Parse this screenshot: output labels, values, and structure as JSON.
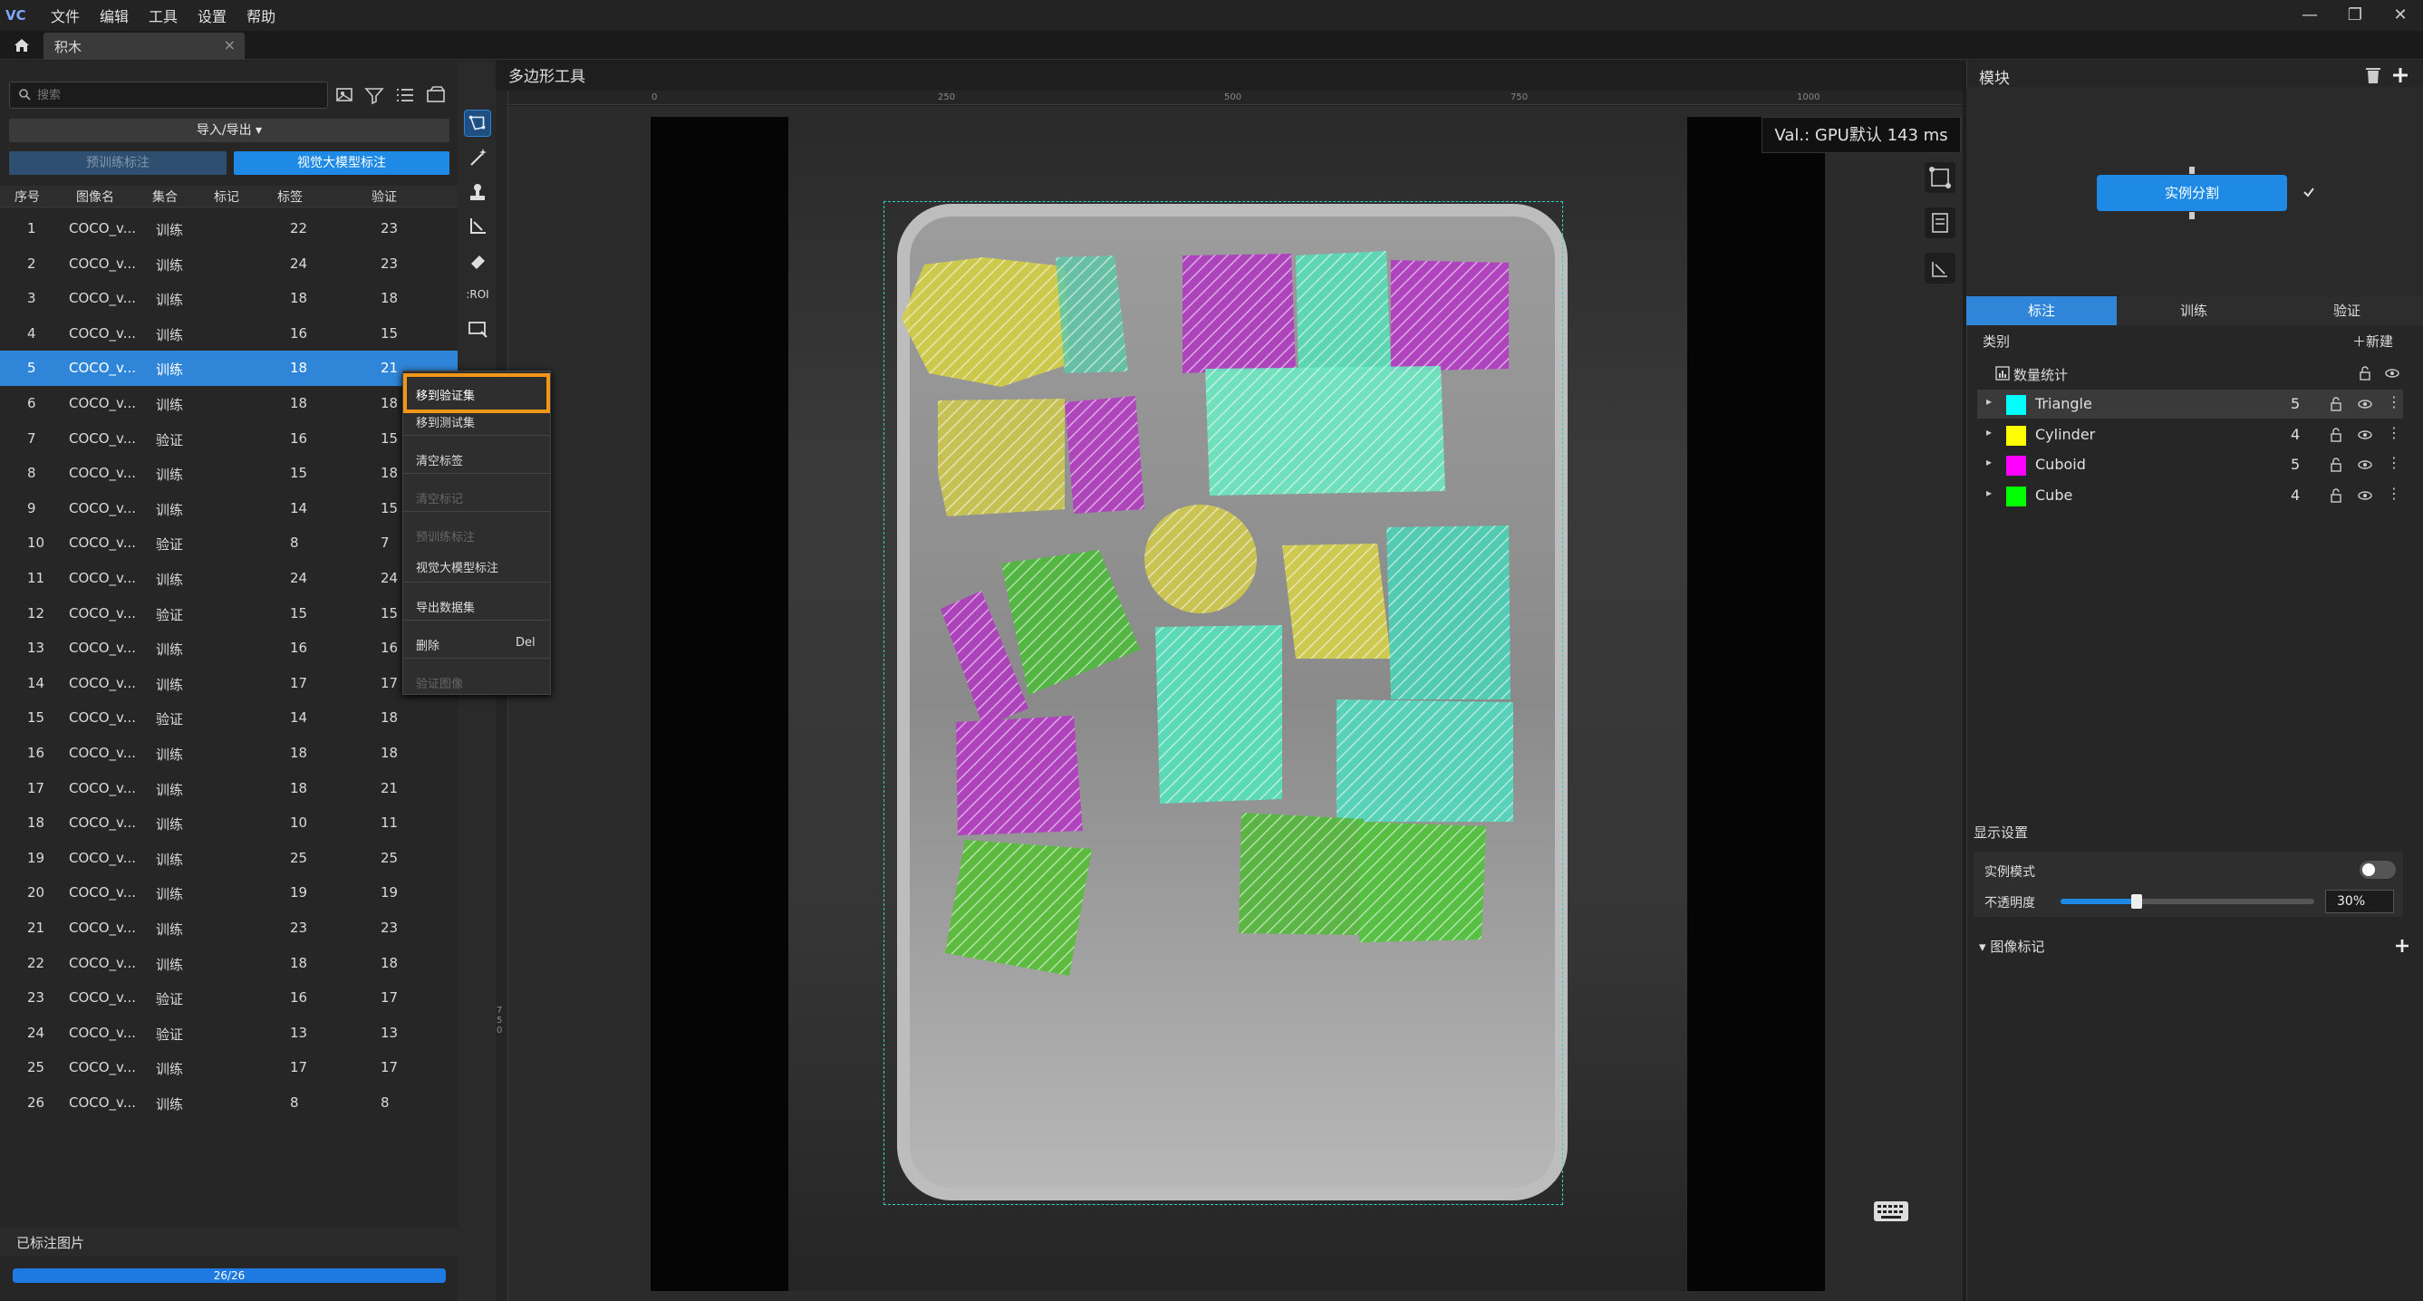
{
  "menubar": {
    "logo": "VC",
    "items": [
      "文件",
      "编辑",
      "工具",
      "设置",
      "帮助"
    ],
    "window_controls": [
      "—",
      "❐",
      "✕"
    ]
  },
  "tab": {
    "label": "积木",
    "close": "×"
  },
  "left": {
    "search_placeholder": "搜索",
    "import_export": "导入/导出 ▾",
    "pretrain_btn": "预训练标注",
    "vlm_btn": "视觉大模型标注",
    "headers": [
      "序号",
      "图像名",
      "集合",
      "标记",
      "标签",
      "验证"
    ],
    "rows": [
      [
        "1",
        "COCO_v...",
        "训练",
        "",
        "22",
        "23"
      ],
      [
        "2",
        "COCO_v...",
        "训练",
        "",
        "24",
        "23"
      ],
      [
        "3",
        "COCO_v...",
        "训练",
        "",
        "18",
        "18"
      ],
      [
        "4",
        "COCO_v...",
        "训练",
        "",
        "16",
        "15"
      ],
      [
        "5",
        "COCO_v...",
        "训练",
        "",
        "18",
        "21"
      ],
      [
        "6",
        "COCO_v...",
        "训练",
        "",
        "18",
        "18"
      ],
      [
        "7",
        "COCO_v...",
        "验证",
        "",
        "16",
        "15"
      ],
      [
        "8",
        "COCO_v...",
        "训练",
        "",
        "15",
        "18"
      ],
      [
        "9",
        "COCO_v...",
        "训练",
        "",
        "14",
        "15"
      ],
      [
        "10",
        "COCO_v...",
        "验证",
        "",
        "8",
        "7"
      ],
      [
        "11",
        "COCO_v...",
        "训练",
        "",
        "24",
        "24"
      ],
      [
        "12",
        "COCO_v...",
        "验证",
        "",
        "15",
        "15"
      ],
      [
        "13",
        "COCO_v...",
        "训练",
        "",
        "16",
        "16"
      ],
      [
        "14",
        "COCO_v...",
        "训练",
        "",
        "17",
        "17"
      ],
      [
        "15",
        "COCO_v...",
        "验证",
        "",
        "14",
        "18"
      ],
      [
        "16",
        "COCO_v...",
        "训练",
        "",
        "18",
        "18"
      ],
      [
        "17",
        "COCO_v...",
        "训练",
        "",
        "18",
        "21"
      ],
      [
        "18",
        "COCO_v...",
        "训练",
        "",
        "10",
        "11"
      ],
      [
        "19",
        "COCO_v...",
        "训练",
        "",
        "25",
        "25"
      ],
      [
        "20",
        "COCO_v...",
        "训练",
        "",
        "19",
        "19"
      ],
      [
        "21",
        "COCO_v...",
        "训练",
        "",
        "23",
        "23"
      ],
      [
        "22",
        "COCO_v...",
        "训练",
        "",
        "18",
        "18"
      ],
      [
        "23",
        "COCO_v...",
        "验证",
        "",
        "16",
        "17"
      ],
      [
        "24",
        "COCO_v...",
        "验证",
        "",
        "13",
        "13"
      ],
      [
        "25",
        "COCO_v...",
        "训练",
        "",
        "17",
        "17"
      ],
      [
        "26",
        "COCO_v...",
        "训练",
        "",
        "8",
        "8"
      ]
    ],
    "selected_row": 5,
    "footer_label": "已标注图片",
    "progress_text": "26/26",
    "progress_fraction": 1.0
  },
  "context_menu": {
    "items": [
      {
        "label": "移到验证集",
        "enabled": true,
        "highlight": true
      },
      {
        "label": "移到测试集",
        "enabled": true
      },
      {
        "label": "清空标签",
        "enabled": true
      },
      {
        "label": "清空标记",
        "enabled": false
      },
      {
        "label": "预训练标注",
        "enabled": false
      },
      {
        "label": "视觉大模型标注",
        "enabled": true
      },
      {
        "label": "导出数据集",
        "enabled": true
      },
      {
        "label": "删除",
        "shortcut": "Del",
        "enabled": true
      },
      {
        "label": "验证图像",
        "enabled": false
      }
    ]
  },
  "canvas": {
    "title": "多边形工具",
    "ruler_ticks": [
      "0",
      "250",
      "500",
      "750",
      "1000"
    ],
    "ruler_v": "750",
    "val_text": "Val.: GPU默认 143 ms"
  },
  "right": {
    "modules_title": "模块",
    "instance_seg_btn": "实例分割",
    "tabs": [
      "标注",
      "训练",
      "验证"
    ],
    "category_label": "类别",
    "new_label": "新建",
    "stats_label": "数量统计",
    "categories": [
      {
        "name": "Triangle",
        "count": "5",
        "color": "#00ffff"
      },
      {
        "name": "Cylinder",
        "count": "4",
        "color": "#ffff00"
      },
      {
        "name": "Cuboid",
        "count": "5",
        "color": "#ff00ff"
      },
      {
        "name": "Cube",
        "count": "4",
        "color": "#00ff00"
      }
    ],
    "display_settings": "显示设置",
    "instance_mode": "实例模式",
    "opacity_label": "不透明度",
    "opacity_value": "30%",
    "opacity_fraction": 0.3,
    "image_mark": "图像标记"
  }
}
